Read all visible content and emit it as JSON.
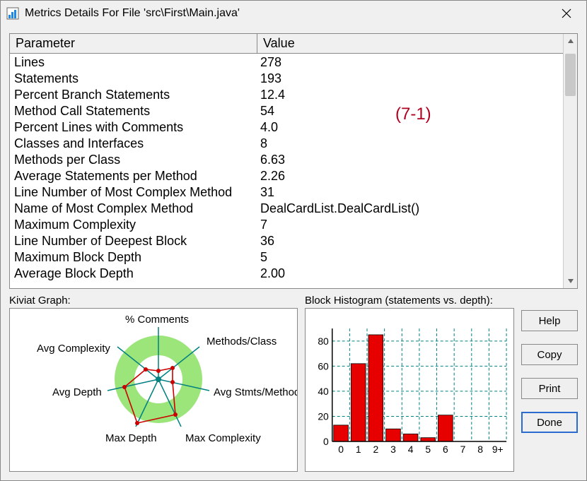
{
  "window": {
    "title": "Metrics Details For File 'src\\First\\Main.java'"
  },
  "table": {
    "header_param": "Parameter",
    "header_value": "Value",
    "rows": [
      {
        "param": "Lines",
        "value": "278"
      },
      {
        "param": "Statements",
        "value": "193"
      },
      {
        "param": "Percent Branch Statements",
        "value": "12.4"
      },
      {
        "param": "Method Call Statements",
        "value": "54"
      },
      {
        "param": "Percent Lines with Comments",
        "value": "4.0"
      },
      {
        "param": "Classes and Interfaces",
        "value": "8"
      },
      {
        "param": "Methods per Class",
        "value": "6.63"
      },
      {
        "param": "Average Statements per Method",
        "value": "2.26"
      },
      {
        "param": "Line Number of Most Complex Method",
        "value": "31"
      },
      {
        "param": "Name of Most Complex Method",
        "value": "DealCardList.DealCardList()"
      },
      {
        "param": "Maximum Complexity",
        "value": "7"
      },
      {
        "param": "Line Number of Deepest Block",
        "value": "36"
      },
      {
        "param": "Maximum Block Depth",
        "value": "5"
      },
      {
        "param": "Average Block Depth",
        "value": "2.00"
      }
    ]
  },
  "annotation": "(7-1)",
  "kiviat": {
    "panel_label": "Kiviat Graph:",
    "labels": {
      "top": "% Comments",
      "ne": "Methods/Class",
      "e": "Avg Stmts/Method",
      "se": "Max Complexity",
      "s": "Max Depth",
      "w": "Avg Depth",
      "nw": "Avg Complexity"
    }
  },
  "histogram": {
    "panel_label": "Block Histogram (statements vs. depth):"
  },
  "buttons": {
    "help": "Help",
    "copy": "Copy",
    "print": "Print",
    "done": "Done"
  },
  "chart_data": {
    "type": "bar",
    "categories": [
      "0",
      "1",
      "2",
      "3",
      "4",
      "5",
      "6",
      "7",
      "8",
      "9+"
    ],
    "values": [
      13,
      62,
      85,
      10,
      6,
      3,
      21,
      0,
      0,
      0
    ],
    "title": "",
    "xlabel": "",
    "ylabel": "",
    "ylim": [
      0,
      90
    ],
    "yticks": [
      0,
      20,
      40,
      60,
      80
    ]
  }
}
